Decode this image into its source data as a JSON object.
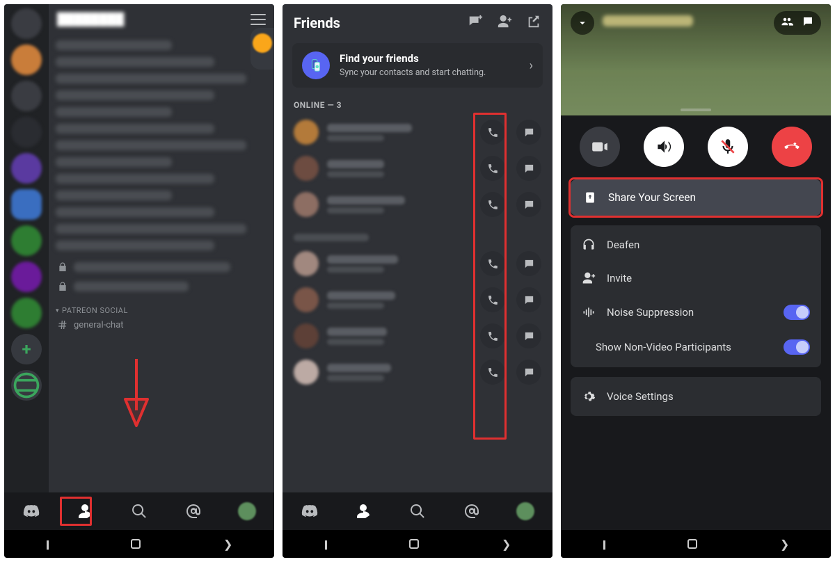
{
  "panel1": {
    "server_title": "████████",
    "category2": "PATREON SOCIAL",
    "general_chat": "general-chat",
    "tabs": [
      "discord",
      "friends",
      "search",
      "mentions",
      "profile"
    ]
  },
  "panel2": {
    "title": "Friends",
    "find_title": "Find your friends",
    "find_sub": "Sync your contacts and start chatting.",
    "online_header": "ONLINE — 3"
  },
  "panel3": {
    "share": "Share Your Screen",
    "deafen": "Deafen",
    "invite": "Invite",
    "noise": "Noise Suppression",
    "nonvideo": "Show Non-Video Participants",
    "voice_settings": "Voice Settings"
  }
}
